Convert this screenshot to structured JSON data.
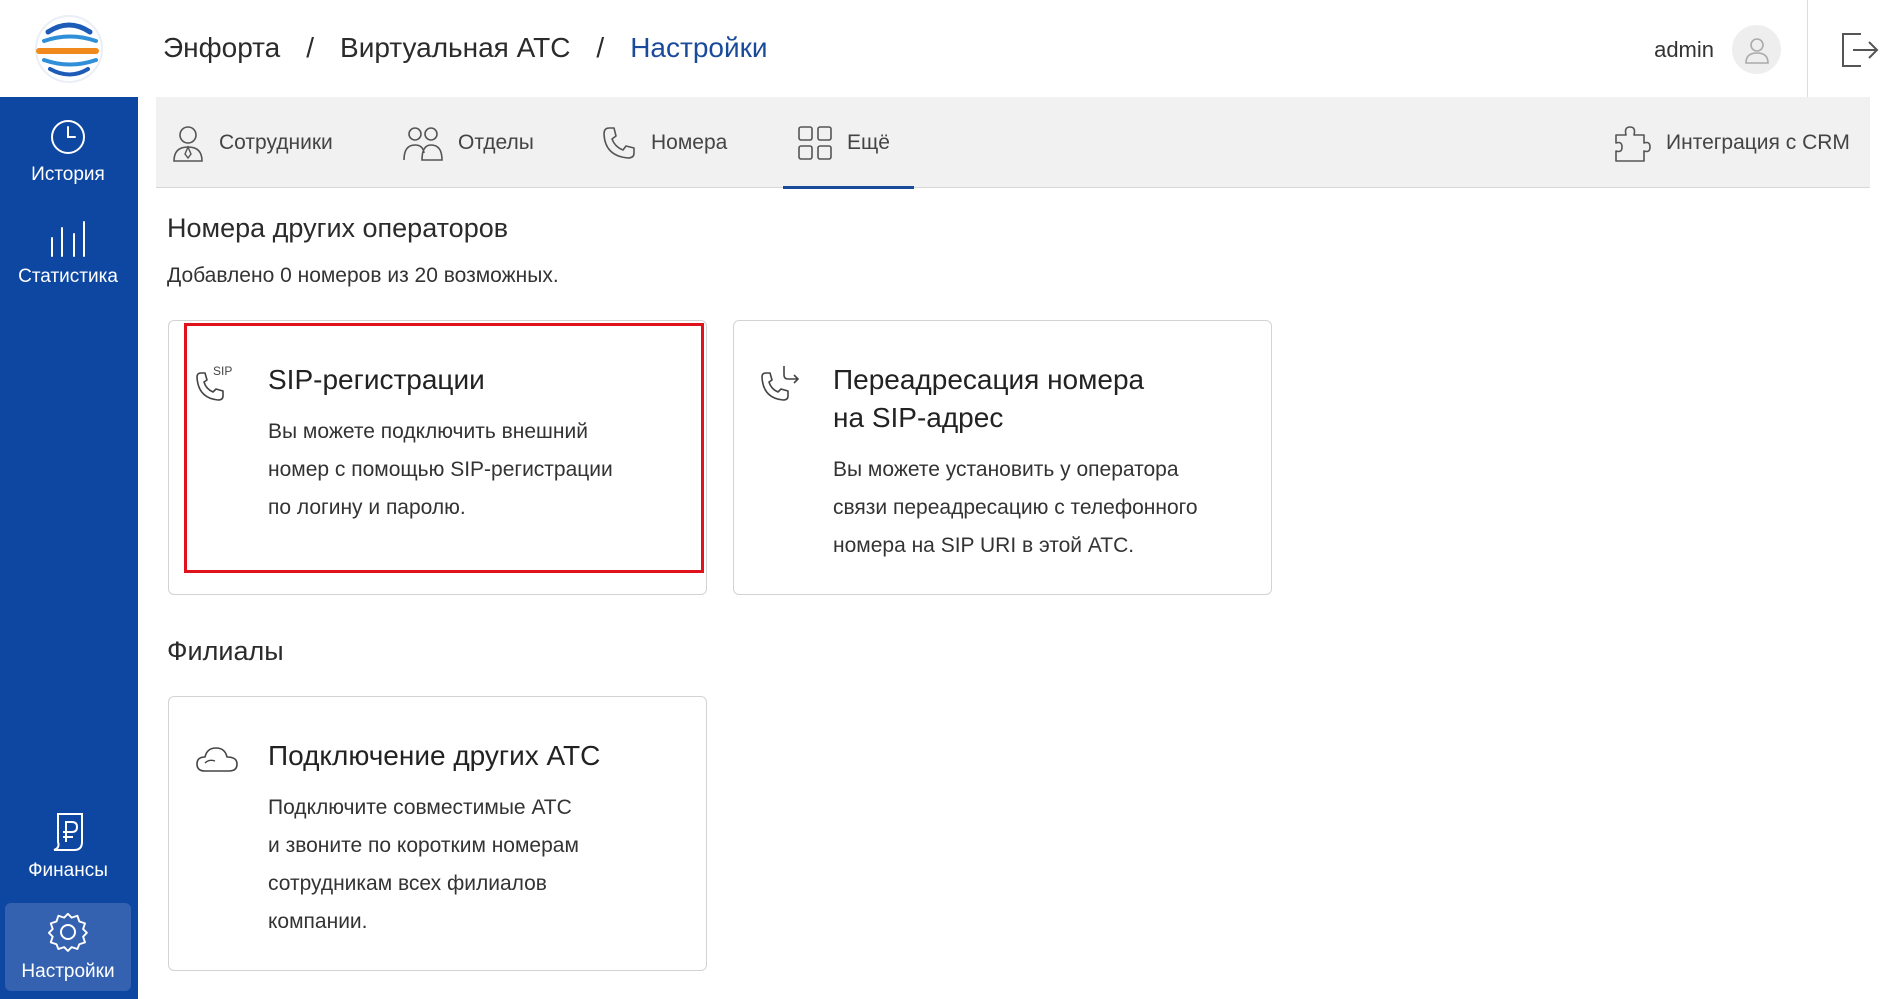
{
  "sidebar": {
    "history": "История",
    "stats": "Статистика",
    "finance": "Финансы",
    "settings": "Настройки"
  },
  "header": {
    "crumb1": "Энфорта",
    "crumb2": "Виртуальная АТС",
    "crumb3": "Настройки",
    "sep": "/",
    "user": "admin"
  },
  "tabs": {
    "employees": "Сотрудники",
    "departments": "Отделы",
    "numbers": "Номера",
    "more": "Ещё",
    "crm": "Интеграция с CRM"
  },
  "content": {
    "section1_title": "Номера других операторов",
    "section1_sub": "Добавлено 0 номеров из 20 возможных.",
    "card_sip": {
      "icon_label": "SIP",
      "title": "SIP-регистрации",
      "desc_1": "Вы можете подключить внешний",
      "desc_2": "номер с помощью SIP-регистрации",
      "desc_3": "по логину и паролю."
    },
    "card_forward": {
      "title_1": "Переадресация номера",
      "title_2": "на SIP-адрес",
      "desc_1": "Вы можете установить у оператора",
      "desc_2": "связи переадресацию с телефонного",
      "desc_3": "номера на SIP URI в этой АТС."
    },
    "section2_title": "Филиалы",
    "card_pbx": {
      "title": "Подключение других АТС",
      "desc_1": "Подключите совместимые АТС",
      "desc_2": "и звоните по коротким номерам",
      "desc_3": "сотрудникам всех филиалов",
      "desc_4": "компании."
    }
  },
  "colors": {
    "sidebar": "#0d47a1",
    "accent": "#1a4b9b",
    "highlight": "#e0121b"
  }
}
